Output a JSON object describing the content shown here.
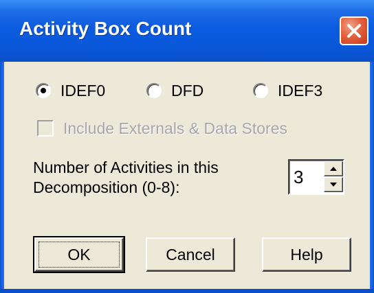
{
  "window": {
    "title": "Activity Box Count"
  },
  "diagram_types": [
    {
      "label": "IDEF0",
      "selected": true
    },
    {
      "label": "DFD",
      "selected": false
    },
    {
      "label": "IDEF3",
      "selected": false
    }
  ],
  "externals": {
    "label": "Include Externals & Data Stores",
    "checked": false,
    "disabled": true
  },
  "activities": {
    "label_line1": "Number of Activities in this",
    "label_line2": "Decomposition (0-8):",
    "value": "3"
  },
  "buttons": {
    "ok": "OK",
    "cancel": "Cancel",
    "help": "Help"
  },
  "icons": {
    "close": "close-icon",
    "spin_up": "arrow-up-icon",
    "spin_down": "arrow-down-icon"
  }
}
